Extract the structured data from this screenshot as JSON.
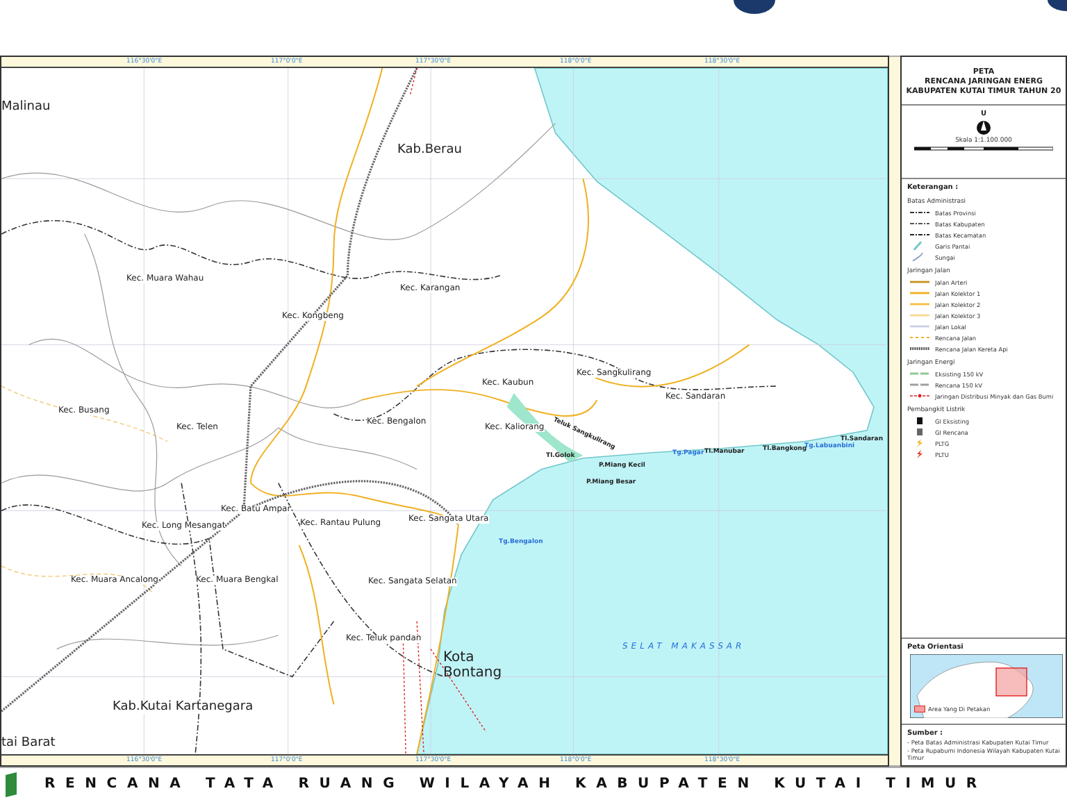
{
  "map": {
    "top_ticks": [
      "116°30'0\"E",
      "117°0'0\"E",
      "117°30'0\"E",
      "118°0'0\"E",
      "118°30'0\"E"
    ],
    "bottom_ticks": [
      "116°30'0\"E",
      "117°0'0\"E",
      "117°30'0\"E",
      "118°0'0\"E",
      "118°30'0\"E"
    ],
    "labels": [
      {
        "kind": "regency",
        "text": "Malinau"
      },
      {
        "kind": "regency",
        "text": "Kab.Berau"
      },
      {
        "kind": "district",
        "text": "Kec. Muara Wahau"
      },
      {
        "kind": "district",
        "text": "Kec. Kongbeng"
      },
      {
        "kind": "district",
        "text": "Kec. Karangan"
      },
      {
        "kind": "district",
        "text": "Kec. Busang"
      },
      {
        "kind": "district",
        "text": "Kec. Telen"
      },
      {
        "kind": "district",
        "text": "Kec. Bengalon"
      },
      {
        "kind": "district",
        "text": "Kec. Kaubun"
      },
      {
        "kind": "district",
        "text": "Kec. Sangkulirang"
      },
      {
        "kind": "district",
        "text": "Kec. Sandaran"
      },
      {
        "kind": "district",
        "text": "Kec. Kaliorang"
      },
      {
        "kind": "district",
        "text": "Kec. Batu Ampar"
      },
      {
        "kind": "district",
        "text": "Kec. Long Mesangat"
      },
      {
        "kind": "district",
        "text": "Kec. Rantau Pulung"
      },
      {
        "kind": "district",
        "text": "Kec. Sangata Utara"
      },
      {
        "kind": "district",
        "text": "Kec. Muara Ancalong"
      },
      {
        "kind": "district",
        "text": "Kec. Muara Bengkal"
      },
      {
        "kind": "district",
        "text": "Kec. Sangata Selatan"
      },
      {
        "kind": "district",
        "text": "Kec. Teluk pandan"
      },
      {
        "kind": "city",
        "text": "Kota"
      },
      {
        "kind": "city",
        "text": "Bontang"
      },
      {
        "kind": "regency",
        "text": "Kab.Kutai Kartanegara"
      },
      {
        "kind": "regency",
        "text": "tai Barat"
      },
      {
        "kind": "sea",
        "text": "SELAT MAKASSAR"
      },
      {
        "kind": "cape",
        "text": "Tg.Bengalon"
      },
      {
        "kind": "cape",
        "text": "Tg.Pagar"
      },
      {
        "kind": "cape",
        "text": "Tg.Labuanbini"
      },
      {
        "kind": "place",
        "text": "Tl.Golok"
      },
      {
        "kind": "place",
        "text": "P.Miang Kecil"
      },
      {
        "kind": "place",
        "text": "P.Miang Besar"
      },
      {
        "kind": "place",
        "text": "Tl.Manubar"
      },
      {
        "kind": "place",
        "text": "Tl.Bangkong"
      },
      {
        "kind": "place",
        "text": "Tl.Sandaran"
      },
      {
        "kind": "place",
        "text": "Teluk Sangkulirang"
      }
    ]
  },
  "legend": {
    "title": [
      "PETA",
      "RENCANA JARINGAN ENERG",
      "KABUPATEN KUTAI TIMUR TAHUN 20"
    ],
    "north": "U",
    "scale": "Skala 1:1.100.000",
    "heading": "Keterangan :",
    "groups": [
      {
        "title": "Batas Administrasi",
        "items": [
          {
            "kind": "boundary",
            "color": "#333333",
            "label": "Batas Provinsi"
          },
          {
            "kind": "boundary",
            "color": "#555555",
            "label": "Batas Kabupaten"
          },
          {
            "kind": "boundary",
            "color": "#222222",
            "label": "Batas Kecamatan"
          }
        ]
      },
      {
        "items": [
          {
            "kind": "coast",
            "color": "#6fc7c9",
            "label": "Garis Pantai"
          },
          {
            "kind": "river",
            "color": "#8fa6c9",
            "label": "Sungai"
          }
        ]
      },
      {
        "title": "Jaringan Jalan",
        "items": [
          {
            "kind": "road",
            "color": "#c8901a",
            "label": "Jalan Arteri"
          },
          {
            "kind": "road",
            "color": "#f0b020",
            "label": "Jalan Kolektor 1"
          },
          {
            "kind": "road",
            "color": "#f5c040",
            "label": "Jalan Kolektor 2"
          },
          {
            "kind": "road",
            "color": "#f8d890",
            "label": "Jalan Kolektor 3"
          },
          {
            "kind": "road",
            "color": "#c8d0e8",
            "label": "Jalan Lokal"
          },
          {
            "kind": "planned-road",
            "color": "#f0b020",
            "label": "Rencana Jalan"
          },
          {
            "kind": "rail",
            "color": "#555555",
            "label": "Rencana Jalan Kereta Api"
          }
        ]
      },
      {
        "title": "Jaringan Energi",
        "items": [
          {
            "kind": "power-line",
            "color": "#90c890",
            "label": "Eksisting 150 kV"
          },
          {
            "kind": "power-line",
            "color": "#a0a0a0",
            "label": "Rencana 150 kV"
          },
          {
            "kind": "pipeline",
            "color": "#e02020",
            "label": "Jaringan Distribusi Minyak dan Gas Bumi"
          }
        ]
      },
      {
        "title": "Pembangkit Listrik",
        "items": [
          {
            "kind": "substation",
            "color": "#111111",
            "label": "GI Eksisting"
          },
          {
            "kind": "substation",
            "color": "#666666",
            "label": "GI Rencana"
          },
          {
            "kind": "plant",
            "color": "#f0b000",
            "label": "PLTG"
          },
          {
            "kind": "plant",
            "color": "#e03010",
            "label": "PLTU"
          }
        ]
      }
    ],
    "orientation": {
      "title": "Peta Orientasi",
      "area_label": "Area Yang Di Petakan"
    },
    "sources": {
      "title": "Sumber :",
      "items": [
        "- Peta Batas Administrasi Kabupaten Kutai Timur",
        "- Peta Rupabumi Indonesia Wilayah Kabupaten Kutai Timur"
      ]
    }
  },
  "footer": {
    "title": "RENCANA TATA RUANG WILAYAH KABUPATEN KUTAI TIMUR"
  }
}
